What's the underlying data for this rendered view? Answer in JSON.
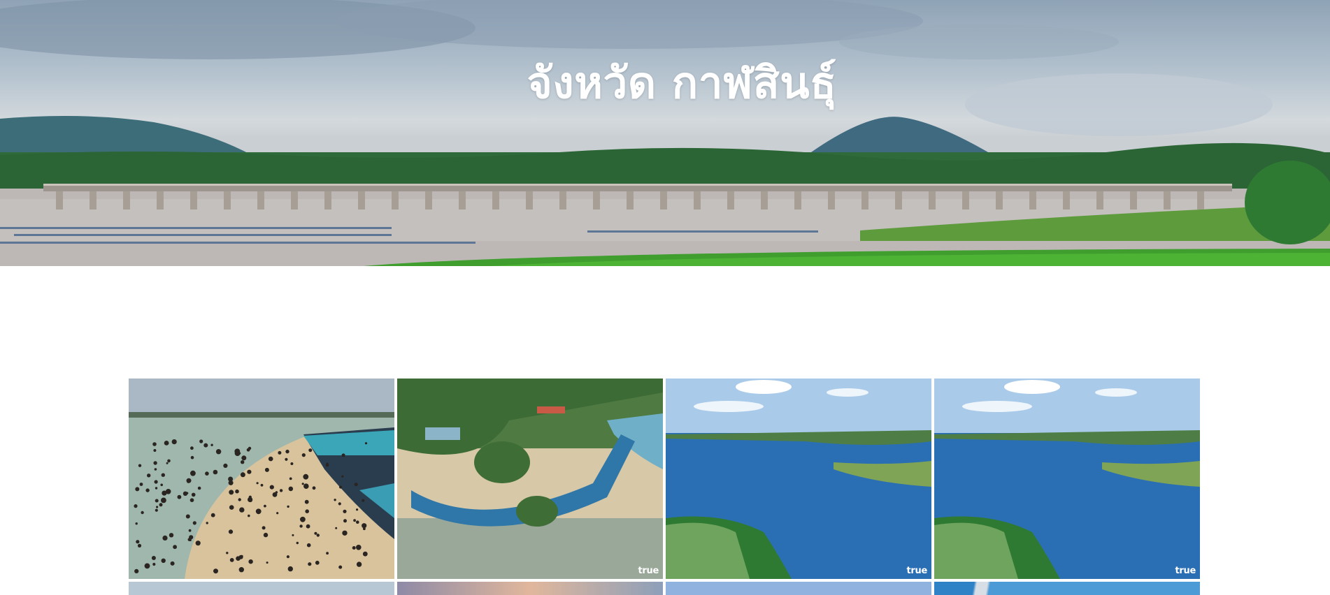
{
  "hero": {
    "title": "จังหวัด กาฬสินธุ์"
  },
  "gallery": {
    "tiles": [
      {
        "kind": "beach-crowd"
      },
      {
        "kind": "aerial-resort",
        "watermark": "true"
      },
      {
        "kind": "dam-lake",
        "watermark": "true"
      },
      {
        "kind": "dam-lake",
        "watermark": "true"
      },
      {
        "kind": "sky-water"
      },
      {
        "kind": "sunset"
      },
      {
        "kind": "sky"
      },
      {
        "kind": "bridge"
      }
    ]
  },
  "colors": {
    "lake": "#2a6fb4",
    "grass": "#3f9e2e",
    "sky": "#a9cbe9"
  }
}
